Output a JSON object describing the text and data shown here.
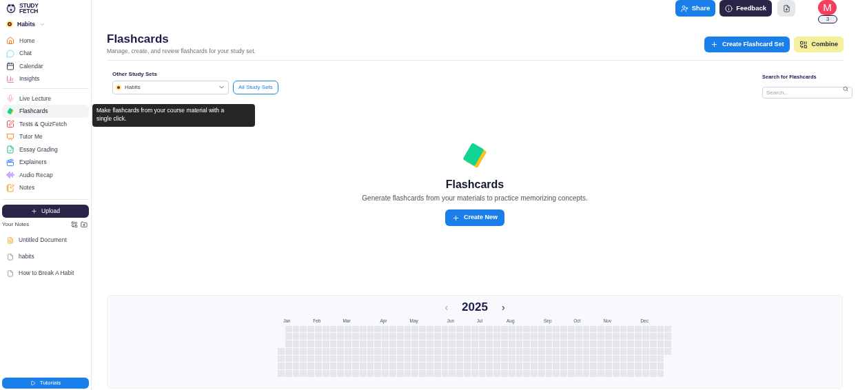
{
  "sidebar": {
    "logo": [
      "STUDY",
      "FETCH"
    ],
    "study_set": "Habits",
    "nav_groups": [
      [
        {
          "label": "Home",
          "selected": false
        },
        {
          "label": "Chat",
          "selected": false
        },
        {
          "label": "Calendar",
          "selected": false
        },
        {
          "label": "Insights",
          "selected": false
        }
      ],
      [
        {
          "label": "Live Lecture",
          "selected": false
        },
        {
          "label": "Flashcards",
          "selected": true
        },
        {
          "label": "Tests & QuizFetch",
          "selected": false
        },
        {
          "label": "Tutor Me",
          "selected": false
        },
        {
          "label": "Essay Grading",
          "selected": false
        },
        {
          "label": "Explainers",
          "selected": false
        },
        {
          "label": "Audio Recap",
          "selected": false
        },
        {
          "label": "Notes",
          "selected": false
        }
      ]
    ],
    "upload_button": "Upload",
    "notes_heading": "Your Notes",
    "notes": [
      {
        "title": "Untitled Document",
        "kind": "document"
      },
      {
        "title": "habits",
        "kind": "file"
      },
      {
        "title": "How to Break A Habit",
        "kind": "file"
      }
    ],
    "tutorials_button": "Tutorials"
  },
  "tooltip": "Make flashcards from your course material with a single click.",
  "topbar": {
    "share": "Share",
    "feedback": "Feedback",
    "avatar": "M",
    "badge": "3"
  },
  "header": {
    "title": "Flashcards",
    "subtitle": "Manage, create, and review flashcards for your study set.",
    "create_button": "Create Flashcard Set",
    "combine_button": "Combine"
  },
  "filters": {
    "study_sets_label": "Other Study Sets",
    "study_set_value": "Habits",
    "all_sets_button": "All Study Sets",
    "search_label": "Search for Flashcards",
    "search_placeholder": "Search..."
  },
  "empty_state": {
    "title": "Flashcards",
    "text": "Generate flashcards from your materials to practice memorizing concepts.",
    "button": "Create New"
  },
  "heatmap": {
    "year": "2025",
    "prev": "‹",
    "next": "›",
    "months": [
      "Jan",
      "Feb",
      "Mar",
      "Apr",
      "May",
      "Jun",
      "Jul",
      "Aug",
      "Sep",
      "Oct",
      "Nov",
      "Dec"
    ]
  }
}
